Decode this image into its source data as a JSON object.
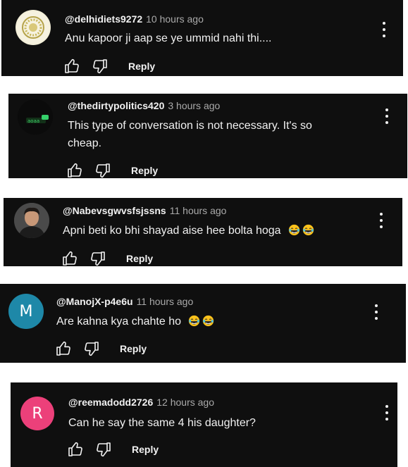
{
  "comments": [
    {
      "handle": "@delhidiets9272",
      "time": "10 hours ago",
      "text": "Anu kapoor ji aap se ye ummid nahi thi....",
      "avatar_letter": "",
      "avatar_color": "#f3efd9",
      "reply_label": "Reply"
    },
    {
      "handle": "@thedirtypolitics420",
      "time": "3 hours ago",
      "text_line1": "This type of conversation is not necessary. It's so",
      "text_line2": "cheap.",
      "avatar_letter": "",
      "avatar_color": "#0b0b0b",
      "reply_label": "Reply"
    },
    {
      "handle": "@Nabevsgwvsfsjssns",
      "time": "11 hours ago",
      "text": "Apni beti ko bhi shayad aise hee bolta hoga",
      "emojis": [
        "laughing-face",
        "laughing-face"
      ],
      "avatar_letter": "",
      "avatar_color": "#3a3a3a",
      "reply_label": "Reply"
    },
    {
      "handle": "@ManojX-p4e6u",
      "time": "11 hours ago",
      "text": "Are kahna kya chahte ho",
      "emojis": [
        "laughing-face",
        "laughing-face"
      ],
      "avatar_letter": "M",
      "avatar_color": "#1e88a8",
      "reply_label": "Reply"
    },
    {
      "handle": "@reemadodd2726",
      "time": "12 hours ago",
      "text": "Can he say the same 4 his daughter?",
      "avatar_letter": "R",
      "avatar_color": "#ec407a",
      "reply_label": "Reply"
    }
  ],
  "icons": {
    "like": "thumbs-up-icon",
    "dislike": "thumbs-down-icon",
    "menu": "more-vert-icon"
  },
  "colors": {
    "card_background": "#0f0f0f",
    "text": "#f1f1f1",
    "secondary_text": "#aaaaaa"
  }
}
